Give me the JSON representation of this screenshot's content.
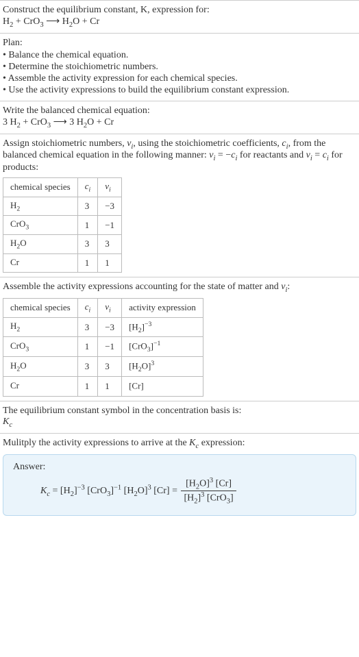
{
  "intro": {
    "line1": "Construct the equilibrium constant, K, expression for:",
    "eq_lhs_h2": "H",
    "eq_lhs_h2_sub": "2",
    "plus1": " + ",
    "eq_lhs_cro3_a": "CrO",
    "eq_lhs_cro3_sub": "3",
    "arrow": " ⟶ ",
    "eq_rhs_h2o_a": "H",
    "eq_rhs_h2o_sub": "2",
    "eq_rhs_h2o_b": "O",
    "plus2": " + ",
    "eq_rhs_cr": "Cr"
  },
  "plan": {
    "title": "Plan:",
    "items": [
      "Balance the chemical equation.",
      "Determine the stoichiometric numbers.",
      "Assemble the activity expression for each chemical species.",
      "Use the activity expressions to build the equilibrium constant expression."
    ]
  },
  "balanced": {
    "title": "Write the balanced chemical equation:",
    "c1": "3 H",
    "c1s": "2",
    "plus1": " + ",
    "c2": "CrO",
    "c2s": "3",
    "arrow": " ⟶ ",
    "c3": "3 H",
    "c3s": "2",
    "c3b": "O",
    "plus2": " + ",
    "c4": "Cr"
  },
  "assign": {
    "text_a": "Assign stoichiometric numbers, ",
    "nu": "ν",
    "nu_i": "i",
    "text_b": ", using the stoichiometric coefficients, ",
    "c": "c",
    "c_i": "i",
    "text_c": ", from the balanced chemical equation in the following manner: ",
    "eq1_l": "ν",
    "eq1_li": "i",
    "eq1_m": " = −",
    "eq1_r": "c",
    "eq1_ri": "i",
    "text_d": " for reactants and ",
    "eq2_l": "ν",
    "eq2_li": "i",
    "eq2_m": " = ",
    "eq2_r": "c",
    "eq2_ri": "i",
    "text_e": " for products:",
    "headers": {
      "h1": "chemical species",
      "h2c": "c",
      "h2i": "i",
      "h3c": "ν",
      "h3i": "i"
    },
    "rows": [
      {
        "sp_a": "H",
        "sp_sub": "2",
        "sp_b": "",
        "c": "3",
        "nu": "−3"
      },
      {
        "sp_a": "CrO",
        "sp_sub": "3",
        "sp_b": "",
        "c": "1",
        "nu": "−1"
      },
      {
        "sp_a": "H",
        "sp_sub": "2",
        "sp_b": "O",
        "c": "3",
        "nu": "3"
      },
      {
        "sp_a": "Cr",
        "sp_sub": "",
        "sp_b": "",
        "c": "1",
        "nu": "1"
      }
    ]
  },
  "activity": {
    "text_a": "Assemble the activity expressions accounting for the state of matter and ",
    "nu": "ν",
    "nu_i": "i",
    "text_b": ":",
    "headers": {
      "h1": "chemical species",
      "h2c": "c",
      "h2i": "i",
      "h3c": "ν",
      "h3i": "i",
      "h4": "activity expression"
    },
    "rows": [
      {
        "sp_a": "H",
        "sp_sub": "2",
        "sp_b": "",
        "c": "3",
        "nu": "−3",
        "ae_a": "[H",
        "ae_sub": "2",
        "ae_b": "]",
        "ae_sup": "−3"
      },
      {
        "sp_a": "CrO",
        "sp_sub": "3",
        "sp_b": "",
        "c": "1",
        "nu": "−1",
        "ae_a": "[CrO",
        "ae_sub": "3",
        "ae_b": "]",
        "ae_sup": "−1"
      },
      {
        "sp_a": "H",
        "sp_sub": "2",
        "sp_b": "O",
        "c": "3",
        "nu": "3",
        "ae_a": "[H",
        "ae_sub": "2",
        "ae_b": "O]",
        "ae_sup": "3"
      },
      {
        "sp_a": "Cr",
        "sp_sub": "",
        "sp_b": "",
        "c": "1",
        "nu": "1",
        "ae_a": "[Cr]",
        "ae_sub": "",
        "ae_b": "",
        "ae_sup": ""
      }
    ]
  },
  "symbol": {
    "text": "The equilibrium constant symbol in the concentration basis is:",
    "K": "K",
    "Kc": "c"
  },
  "mult": {
    "text_a": "Mulitply the activity expressions to arrive at the ",
    "K": "K",
    "Kc": "c",
    "text_b": " expression:"
  },
  "answer": {
    "label": "Answer:",
    "K": "K",
    "Kc": "c",
    "eq": " = ",
    "t1a": "[H",
    "t1s": "2",
    "t1b": "]",
    "t1p": "−3",
    "sp1": " ",
    "t2a": "[CrO",
    "t2s": "3",
    "t2b": "]",
    "t2p": "−1",
    "sp2": " ",
    "t3a": "[H",
    "t3s": "2",
    "t3b": "O]",
    "t3p": "3",
    "sp3": " ",
    "t4": "[Cr]",
    "eq2": " = ",
    "num_a": "[H",
    "num_as": "2",
    "num_ab": "O]",
    "num_ap": "3",
    "num_sp": " ",
    "num_b": "[Cr]",
    "den_a": "[H",
    "den_as": "2",
    "den_ab": "]",
    "den_ap": "3",
    "den_sp": " ",
    "den_b": "[CrO",
    "den_bs": "3",
    "den_bb": "]"
  },
  "chart_data": {
    "type": "table",
    "tables": [
      {
        "title": "Stoichiometric numbers",
        "columns": [
          "chemical species",
          "c_i",
          "ν_i"
        ],
        "rows": [
          [
            "H2",
            3,
            -3
          ],
          [
            "CrO3",
            1,
            -1
          ],
          [
            "H2O",
            3,
            3
          ],
          [
            "Cr",
            1,
            1
          ]
        ]
      },
      {
        "title": "Activity expressions",
        "columns": [
          "chemical species",
          "c_i",
          "ν_i",
          "activity expression"
        ],
        "rows": [
          [
            "H2",
            3,
            -3,
            "[H2]^-3"
          ],
          [
            "CrO3",
            1,
            -1,
            "[CrO3]^-1"
          ],
          [
            "H2O",
            3,
            3,
            "[H2O]^3"
          ],
          [
            "Cr",
            1,
            1,
            "[Cr]"
          ]
        ]
      }
    ]
  }
}
